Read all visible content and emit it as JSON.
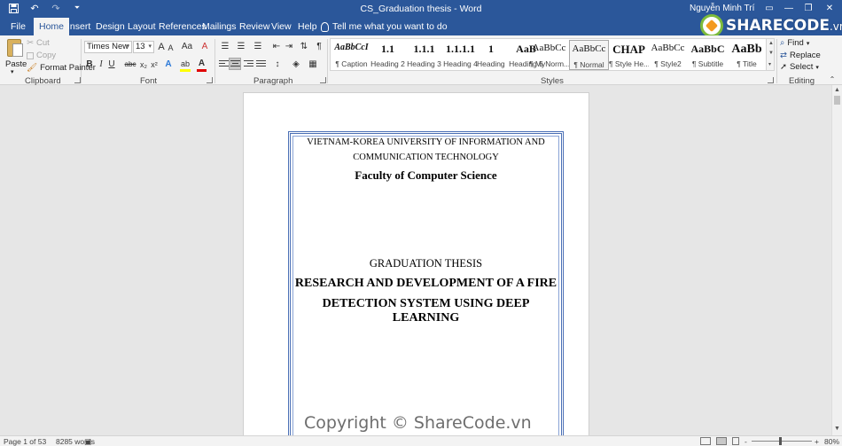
{
  "titlebar": {
    "doc_title": "CS_Graduation thesis - Word",
    "user_name": "Nguyễn Minh Trí",
    "qat": [
      "save-icon",
      "undo-icon",
      "redo-icon",
      "customize-icon"
    ],
    "window_controls": [
      "ribbon-options-icon",
      "minimize-icon",
      "restore-icon",
      "close-icon"
    ]
  },
  "logo": {
    "brand": "SHARECODE",
    "suffix": ".vn"
  },
  "tabs": [
    "File",
    "Home",
    "Insert",
    "Design",
    "Layout",
    "References",
    "Mailings",
    "Review",
    "View",
    "Help"
  ],
  "active_tab": "Home",
  "tell_me": "Tell me what you want to do",
  "clipboard": {
    "paste": "Paste",
    "cut": "Cut",
    "copy": "Copy",
    "format_painter": "Format Painter",
    "label": "Clipboard"
  },
  "font": {
    "family": "Times New Ro",
    "size": "13",
    "grow": "A",
    "shrink": "A",
    "case": "Aa",
    "bold": "B",
    "italic": "I",
    "underline": "U",
    "strikethrough": "abc",
    "subscript": "x₂",
    "superscript": "x²",
    "text_effects": "A",
    "highlight": "ab",
    "font_color": "A",
    "label": "Font",
    "highlight_color": "#ffff00",
    "font_color_value": "#e00000"
  },
  "paragraph": {
    "label": "Paragraph",
    "pilcrow": "¶",
    "active_alignment": "center"
  },
  "styles": {
    "label": "Styles",
    "items": [
      {
        "sample": "AaBbCcI",
        "name": "¶ Caption"
      },
      {
        "sample": "1.1",
        "name": "Heading 2"
      },
      {
        "sample": "1.1.1",
        "name": "Heading 3"
      },
      {
        "sample": "1.1.1.1",
        "name": "Heading 4"
      },
      {
        "sample": "1",
        "name": "Heading 5"
      },
      {
        "sample": "AaB",
        "name": "Heading 5"
      },
      {
        "sample": "AaBbCc",
        "name": "¶ MyNorm..."
      },
      {
        "sample": "AaBbCc",
        "name": "¶ Normal"
      },
      {
        "sample": "CHAP",
        "name": "¶ Style He..."
      },
      {
        "sample": "AaBbCc",
        "name": "¶ Style2"
      },
      {
        "sample": "AaBbC",
        "name": "¶ Subtitle"
      },
      {
        "sample": "AaBb",
        "name": "¶ Title"
      }
    ],
    "selected": "¶ Normal"
  },
  "editing": {
    "find": "Find",
    "replace": "Replace",
    "select": "Select",
    "label": "Editing"
  },
  "document": {
    "univ_line1": "VIETNAM-KOREA UNIVERSITY OF INFORMATION AND",
    "univ_line2": "COMMUNICATION TECHNOLOGY",
    "faculty": "Faculty of Computer Science",
    "thesis_type": "GRADUATION THESIS",
    "title_line1": "RESEARCH AND DEVELOPMENT OF A FIRE",
    "title_line2": "DETECTION SYSTEM USING DEEP LEARNING"
  },
  "watermark": "Copyright © ShareCode.vn",
  "status": {
    "page": "Page 1 of 53",
    "words": "8285 words",
    "zoom": "80%",
    "zoom_minus": "-",
    "zoom_plus": "+"
  }
}
